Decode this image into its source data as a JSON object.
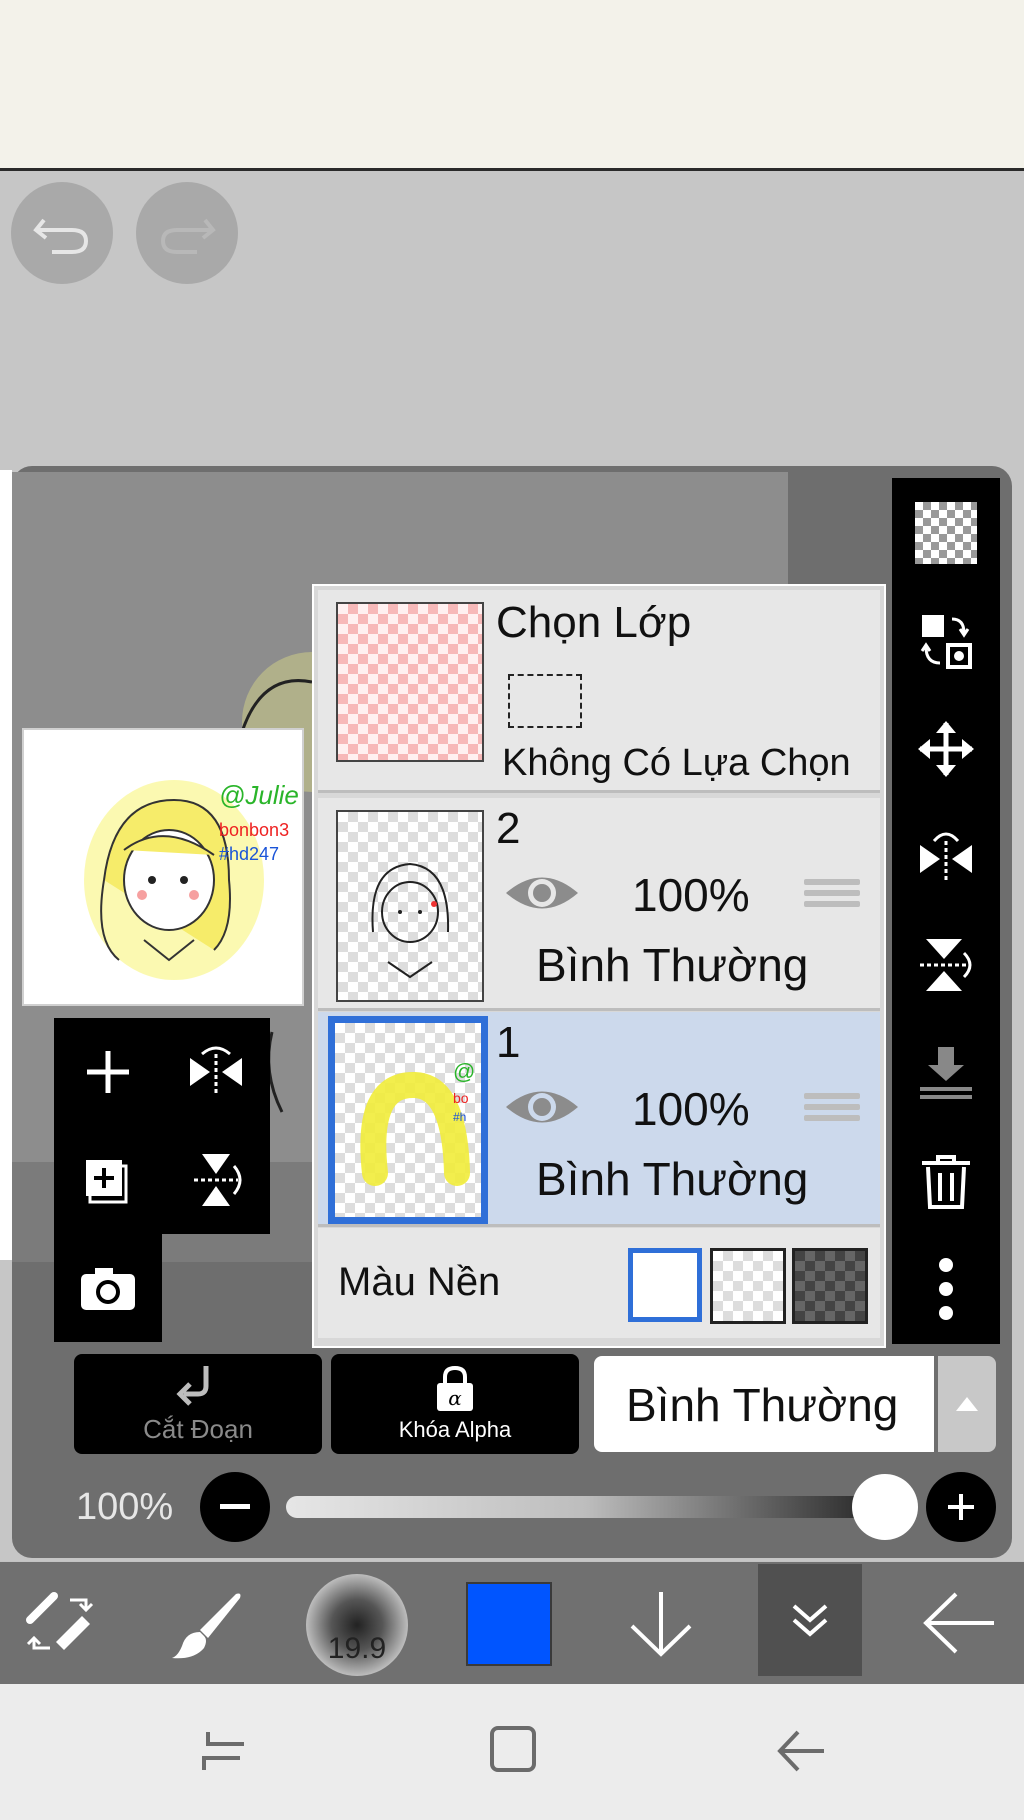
{
  "layers_panel": {
    "selection_layer": {
      "title": "Chọn Lớp",
      "subtitle": "Không Có Lựa Chọn"
    },
    "layers": [
      {
        "number": "2",
        "opacity": "100%",
        "blend": "Bình Thường"
      },
      {
        "number": "1",
        "opacity": "100%",
        "blend": "Bình Thường",
        "selected": true
      }
    ],
    "background": {
      "label": "Màu Nền"
    }
  },
  "preview": {
    "text1": "@Julie",
    "text2": "bonbon3",
    "text3": "#hd247"
  },
  "layer_controls": {
    "clipping_label": "Cắt Đoạn",
    "alpha_lock_label": "Khóa Alpha",
    "blend_mode": "Bình Thường"
  },
  "opacity": {
    "value": "100%",
    "level": 1.0
  },
  "brush": {
    "size": "19.9"
  },
  "colors": {
    "current": "#0055ff",
    "selection_highlight": "#ccd9ec",
    "accent": "#3a78d8"
  }
}
